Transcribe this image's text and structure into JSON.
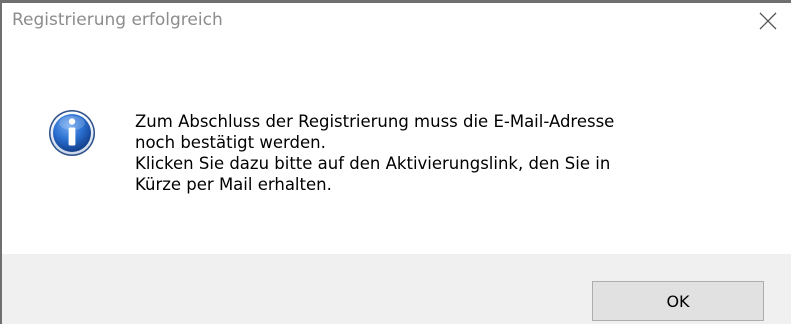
{
  "window": {
    "title": "Registrierung erfolgreich",
    "close_icon": "close-icon"
  },
  "message": {
    "icon": "info-icon",
    "paragraph1": "Zum Abschluss der Registrierung muss die E-Mail-Adresse\nnoch bestätigt werden.",
    "paragraph2": "Klicken Sie dazu bitte auf den Aktivierungslink, den Sie in\nKürze per Mail erhalten."
  },
  "buttons": {
    "ok_label": "OK"
  },
  "colors": {
    "title_text": "#8c8c8c",
    "footer_bg": "#f0f0f0",
    "button_bg": "#e1e1e1",
    "button_border": "#adadad",
    "icon_blue": "#1c5fb8"
  }
}
